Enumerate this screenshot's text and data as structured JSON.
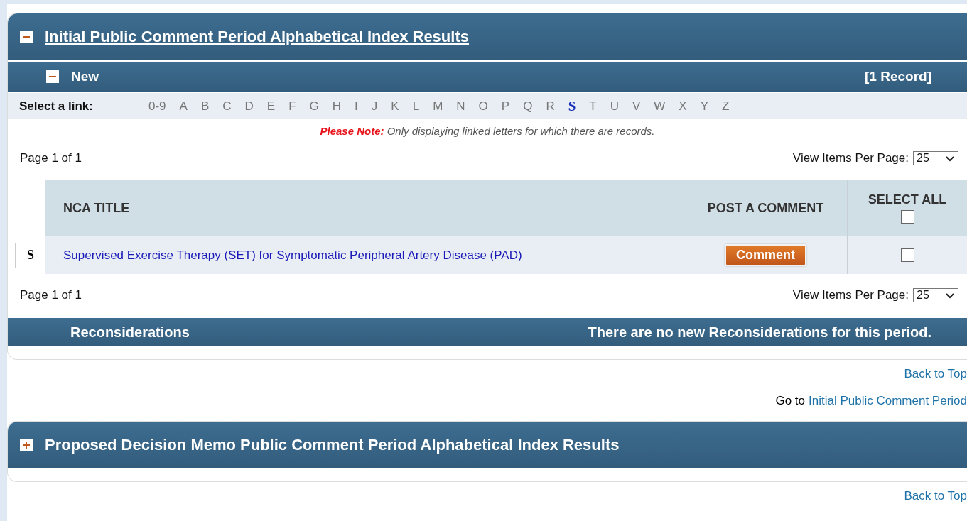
{
  "initial_section": {
    "title": "Initial Public Comment Period Alphabetical Index Results",
    "expanded": true,
    "new_bar": {
      "label": "New",
      "expanded": true,
      "count": "[1 Record]"
    },
    "link_bar": {
      "label": "Select a link:",
      "letters": [
        {
          "text": "0-9",
          "selected": false
        },
        {
          "text": "A",
          "selected": false
        },
        {
          "text": "B",
          "selected": false
        },
        {
          "text": "C",
          "selected": false
        },
        {
          "text": "D",
          "selected": false
        },
        {
          "text": "E",
          "selected": false
        },
        {
          "text": "F",
          "selected": false
        },
        {
          "text": "G",
          "selected": false
        },
        {
          "text": "H",
          "selected": false
        },
        {
          "text": "I",
          "selected": false
        },
        {
          "text": "J",
          "selected": false
        },
        {
          "text": "K",
          "selected": false
        },
        {
          "text": "L",
          "selected": false
        },
        {
          "text": "M",
          "selected": false
        },
        {
          "text": "N",
          "selected": false
        },
        {
          "text": "O",
          "selected": false
        },
        {
          "text": "P",
          "selected": false
        },
        {
          "text": "Q",
          "selected": false
        },
        {
          "text": "R",
          "selected": false
        },
        {
          "text": "S",
          "selected": true
        },
        {
          "text": "T",
          "selected": false
        },
        {
          "text": "U",
          "selected": false
        },
        {
          "text": "V",
          "selected": false
        },
        {
          "text": "W",
          "selected": false
        },
        {
          "text": "X",
          "selected": false
        },
        {
          "text": "Y",
          "selected": false
        },
        {
          "text": "Z",
          "selected": false
        }
      ]
    },
    "note": {
      "label": "Please Note:",
      "text": "Only displaying linked letters for which there are records."
    },
    "pager_top": {
      "page": "Page 1 of 1",
      "per_page_label": "View Items Per Page:",
      "per_page": "25"
    },
    "table": {
      "columns": [
        "NCA TITLE",
        "POST A COMMENT",
        "SELECT ALL"
      ],
      "select_all_checked": false,
      "rows": [
        {
          "letter": "S",
          "title": "Supervised Exercise Therapy (SET) for Symptomatic Peripheral Artery Disease (PAD)",
          "button": "Comment",
          "checked": false
        }
      ]
    },
    "pager_bottom": {
      "page": "Page 1 of 1",
      "per_page_label": "View Items Per Page:",
      "per_page": "25"
    },
    "reconsiderations": {
      "label": "Reconsiderations",
      "message": "There are no new Reconsiderations for this period."
    }
  },
  "back_to_top_1": "Back to Top",
  "goto": {
    "prefix": "Go to",
    "link": "Initial Public Comment Period"
  },
  "proposed_section": {
    "title": "Proposed Decision Memo Public Comment Period Alphabetical Index Results",
    "expanded": false
  },
  "back_to_top_2": "Back to Top"
}
